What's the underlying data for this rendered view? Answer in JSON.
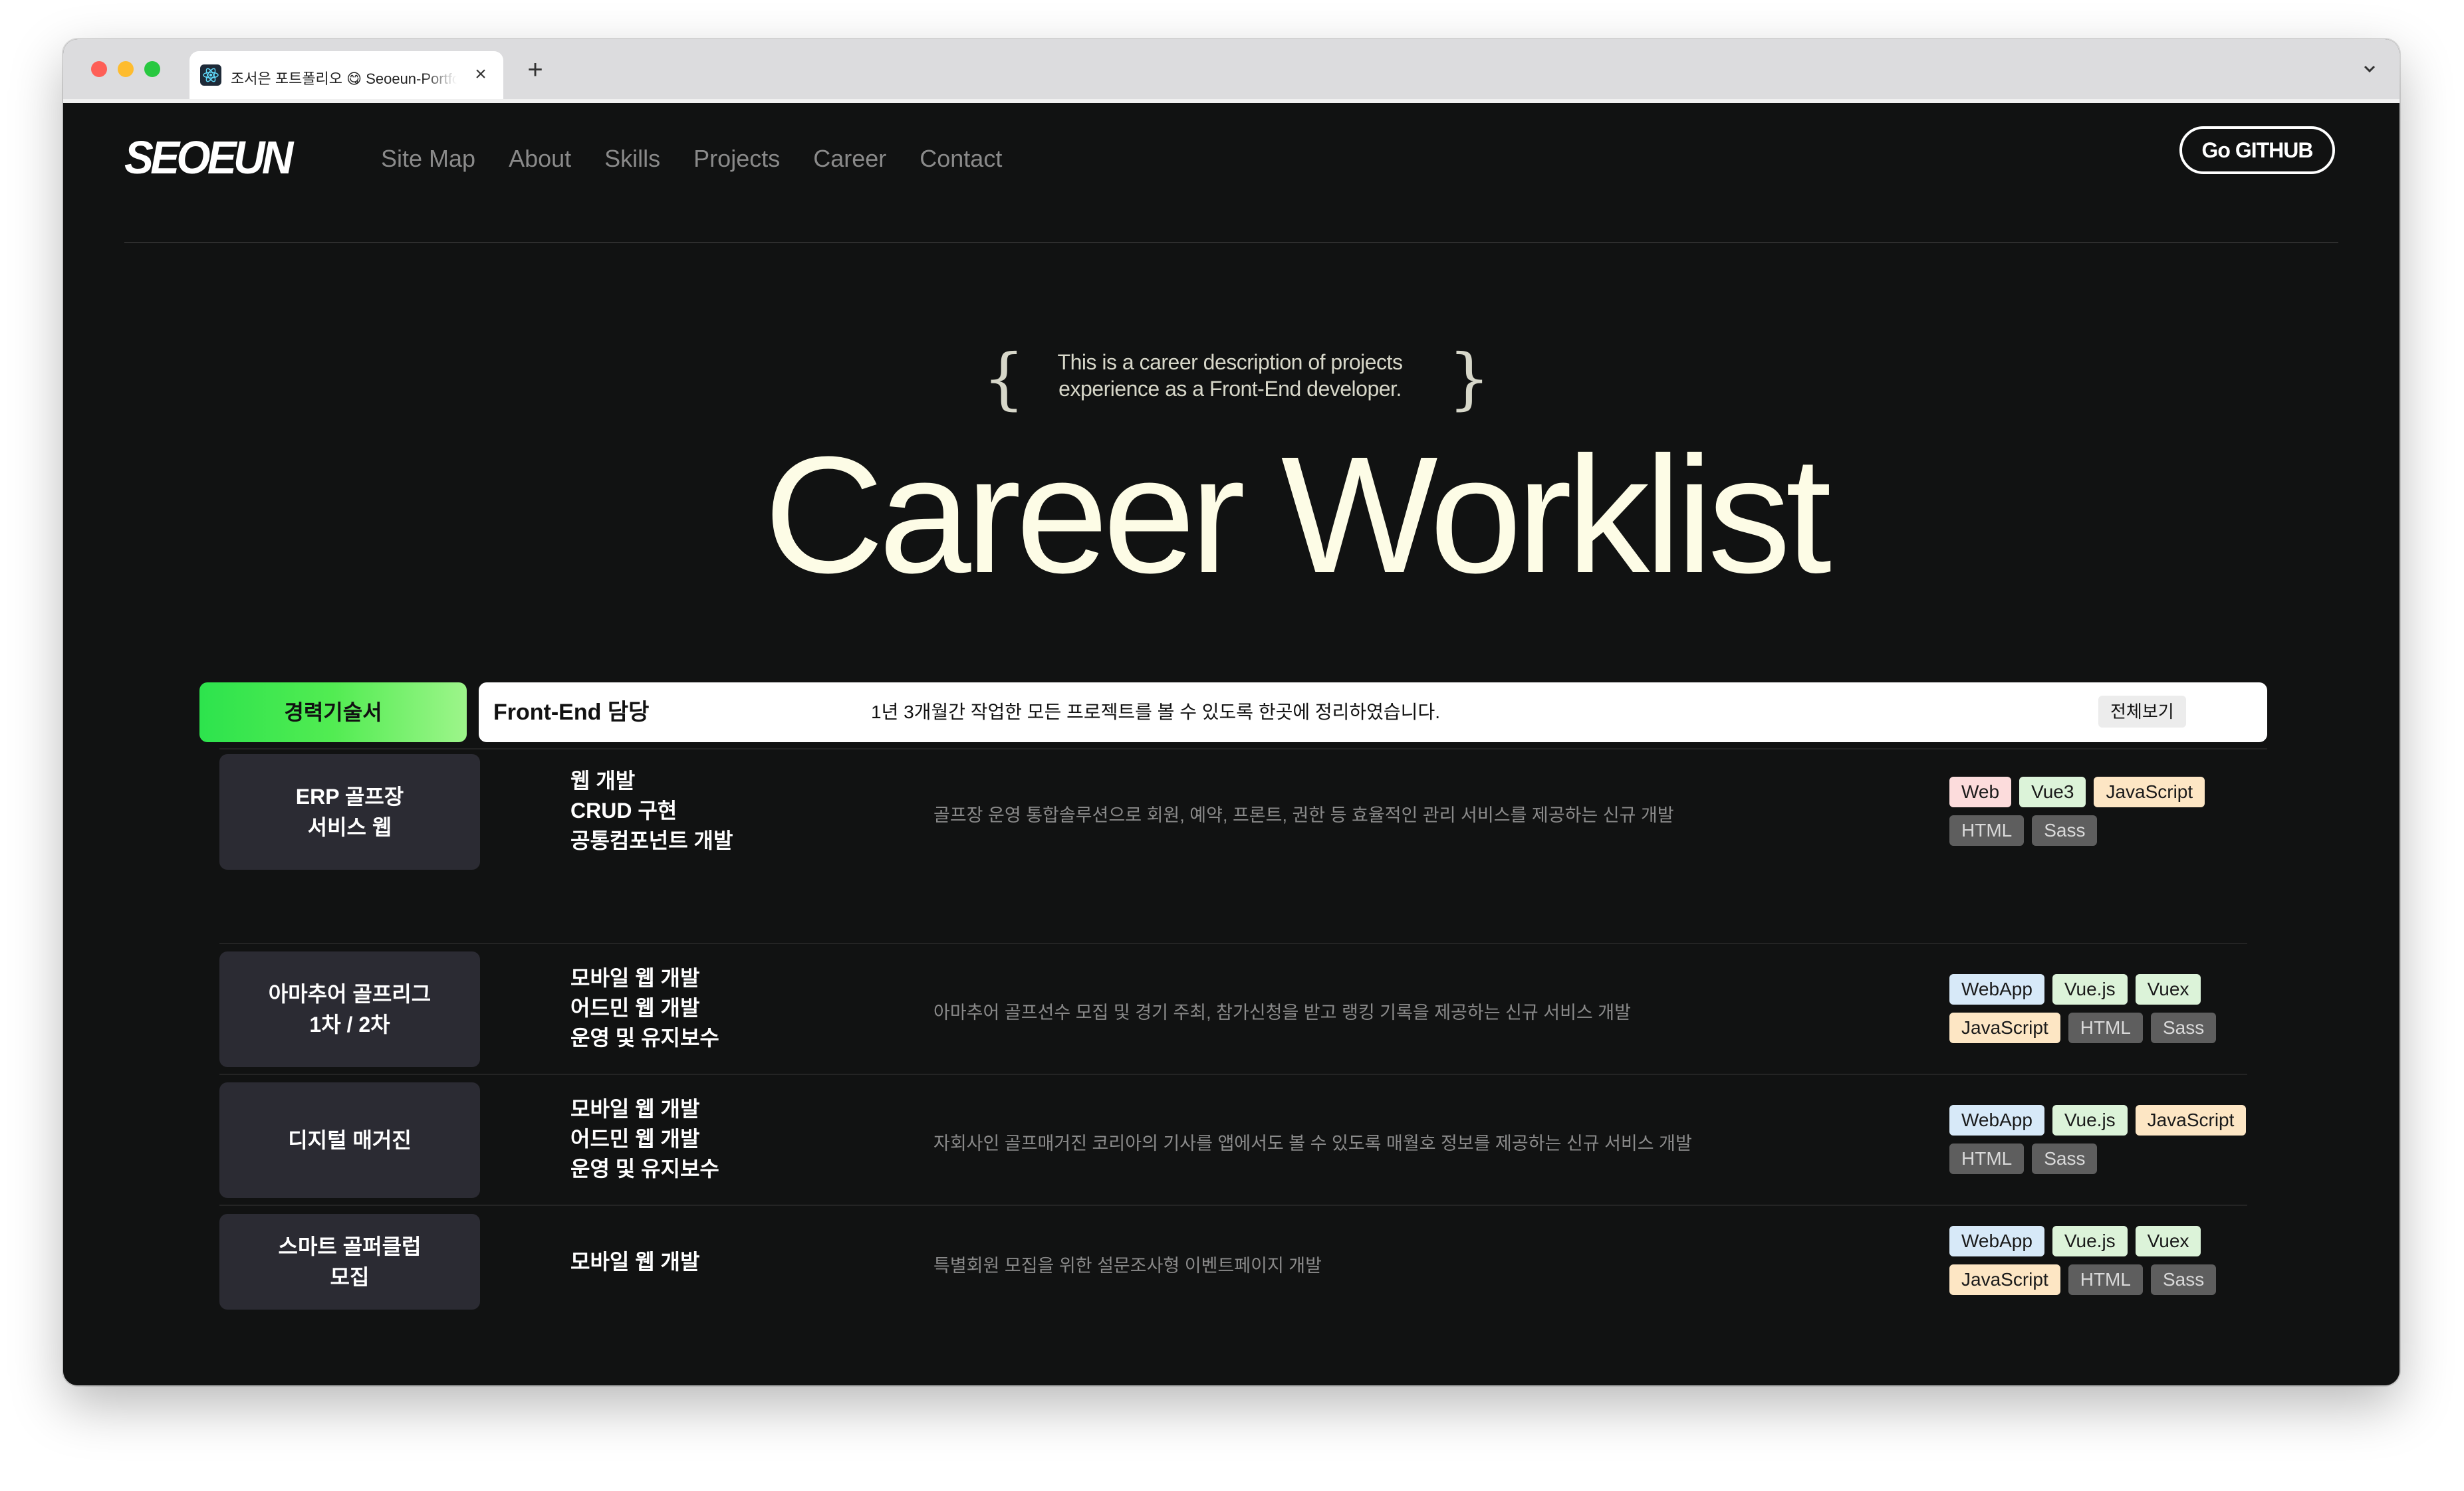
{
  "browser": {
    "tab_title": "조서은 포트폴리오 😋 Seoeun-Portfolio",
    "close_glyph": "×",
    "new_tab_glyph": "+",
    "icons": [
      "react-favicon-icon",
      "close-icon",
      "plus-icon",
      "chevron-down-icon"
    ]
  },
  "header": {
    "logo": "SEOEUN",
    "nav": [
      "Site Map",
      "About",
      "Skills",
      "Projects",
      "Career",
      "Contact"
    ],
    "github_button": "Go GITHUB"
  },
  "hero": {
    "brace_open": "{",
    "brace_close": "}",
    "subtitle_line1": "This is a career description of projects",
    "subtitle_line2": "experience as a Front-End developer.",
    "title": "Career Worklist"
  },
  "table": {
    "badge": "경력기술서",
    "role": "Front-End 담당",
    "summary": "1년 3개월간 작업한 모든 프로젝트를 볼 수 있도록 한곳에 정리하였습니다.",
    "view_all": "전체보기",
    "rows": [
      {
        "project_line1": "ERP 골프장",
        "project_line2": "서비스 웹",
        "tasks": [
          "웹 개발",
          "CRUD 구현",
          "공통컴포넌트 개발"
        ],
        "description": "골프장 운영 통합솔루션으로 회원, 예약, 프론트, 권한 등 효율적인 관리 서비스를 제공하는 신규 개발",
        "tags": [
          "Web",
          "Vue3",
          "JavaScript",
          "HTML",
          "Sass"
        ]
      },
      {
        "project_line1": "아마추어 골프리그",
        "project_line2": "1차 / 2차",
        "tasks": [
          "모바일 웹 개발",
          "어드민 웹 개발",
          "운영 및 유지보수"
        ],
        "description": "아마추어 골프선수 모집 및 경기 주최, 참가신청을 받고 랭킹 기록을 제공하는 신규 서비스 개발",
        "tags": [
          "WebApp",
          "Vue.js",
          "Vuex",
          "JavaScript",
          "HTML",
          "Sass"
        ]
      },
      {
        "project_line1": "디지털 매거진",
        "project_line2": "",
        "tasks": [
          "모바일 웹 개발",
          "어드민 웹 개발",
          "운영 및 유지보수"
        ],
        "description": "자회사인 골프매거진 코리아의 기사를 앱에서도 볼 수 있도록 매월호 정보를 제공하는 신규 서비스 개발",
        "tags": [
          "WebApp",
          "Vue.js",
          "JavaScript",
          "HTML",
          "Sass"
        ]
      },
      {
        "project_line1": "스마트 골퍼클럽",
        "project_line2": "모집",
        "tasks": [
          "모바일 웹 개발"
        ],
        "description": "특별회원 모집을 위한 설문조사형 이벤트페이지 개발",
        "tags": [
          "WebApp",
          "Vue.js",
          "Vuex",
          "JavaScript",
          "HTML",
          "Sass"
        ]
      }
    ]
  },
  "colors": {
    "page_bg": "#111212",
    "hero_text": "#fdfce6",
    "badge_green": "#2de34d",
    "tag_pink": "#fcdcdc",
    "tag_green": "#dcf3d9",
    "tag_cream": "#fde6c4",
    "tag_blue": "#d7e9f8",
    "tag_gray": "#5e5e5e"
  }
}
